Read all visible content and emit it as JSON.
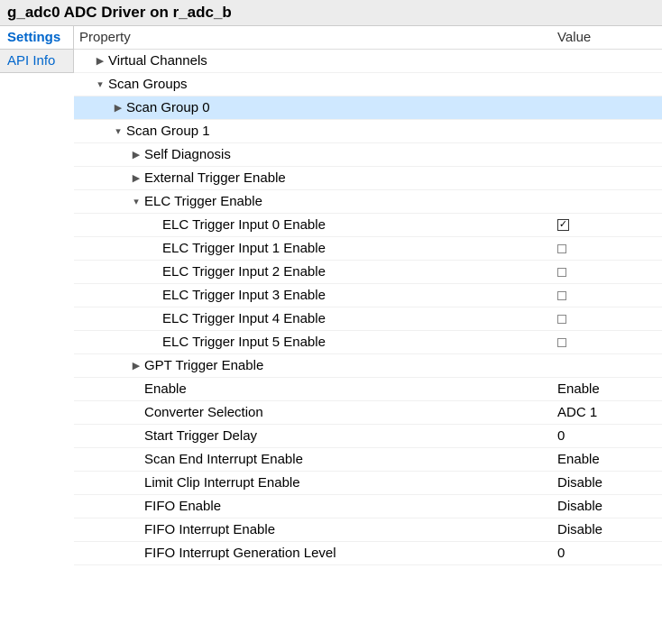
{
  "title": "g_adc0 ADC Driver on r_adc_b",
  "sidebar": {
    "tabs": [
      {
        "label": "Settings",
        "active": true
      },
      {
        "label": "API Info",
        "active": false
      }
    ]
  },
  "columns": {
    "property": "Property",
    "value": "Value"
  },
  "tree": {
    "virtual_channels": "Virtual Channels",
    "scan_groups": "Scan Groups",
    "scan_group_0": "Scan Group 0",
    "scan_group_1": "Scan Group 1",
    "self_diagnosis": "Self Diagnosis",
    "ext_trigger_enable": "External Trigger Enable",
    "elc_trigger_enable": "ELC Trigger Enable",
    "elc_inputs": [
      {
        "label": "ELC Trigger Input 0 Enable",
        "checked": true
      },
      {
        "label": "ELC Trigger Input 1 Enable",
        "checked": false
      },
      {
        "label": "ELC Trigger Input 2 Enable",
        "checked": false
      },
      {
        "label": "ELC Trigger Input 3 Enable",
        "checked": false
      },
      {
        "label": "ELC Trigger Input 4 Enable",
        "checked": false
      },
      {
        "label": "ELC Trigger Input 5 Enable",
        "checked": false
      }
    ],
    "gpt_trigger_enable": "GPT Trigger Enable",
    "props": [
      {
        "label": "Enable",
        "value": "Enable"
      },
      {
        "label": "Converter Selection",
        "value": "ADC 1"
      },
      {
        "label": "Start Trigger Delay",
        "value": "0"
      },
      {
        "label": "Scan End Interrupt Enable",
        "value": "Enable"
      },
      {
        "label": "Limit Clip Interrupt Enable",
        "value": "Disable"
      },
      {
        "label": "FIFO Enable",
        "value": "Disable"
      },
      {
        "label": "FIFO Interrupt Enable",
        "value": "Disable"
      },
      {
        "label": "FIFO Interrupt Generation Level",
        "value": "0"
      }
    ]
  }
}
